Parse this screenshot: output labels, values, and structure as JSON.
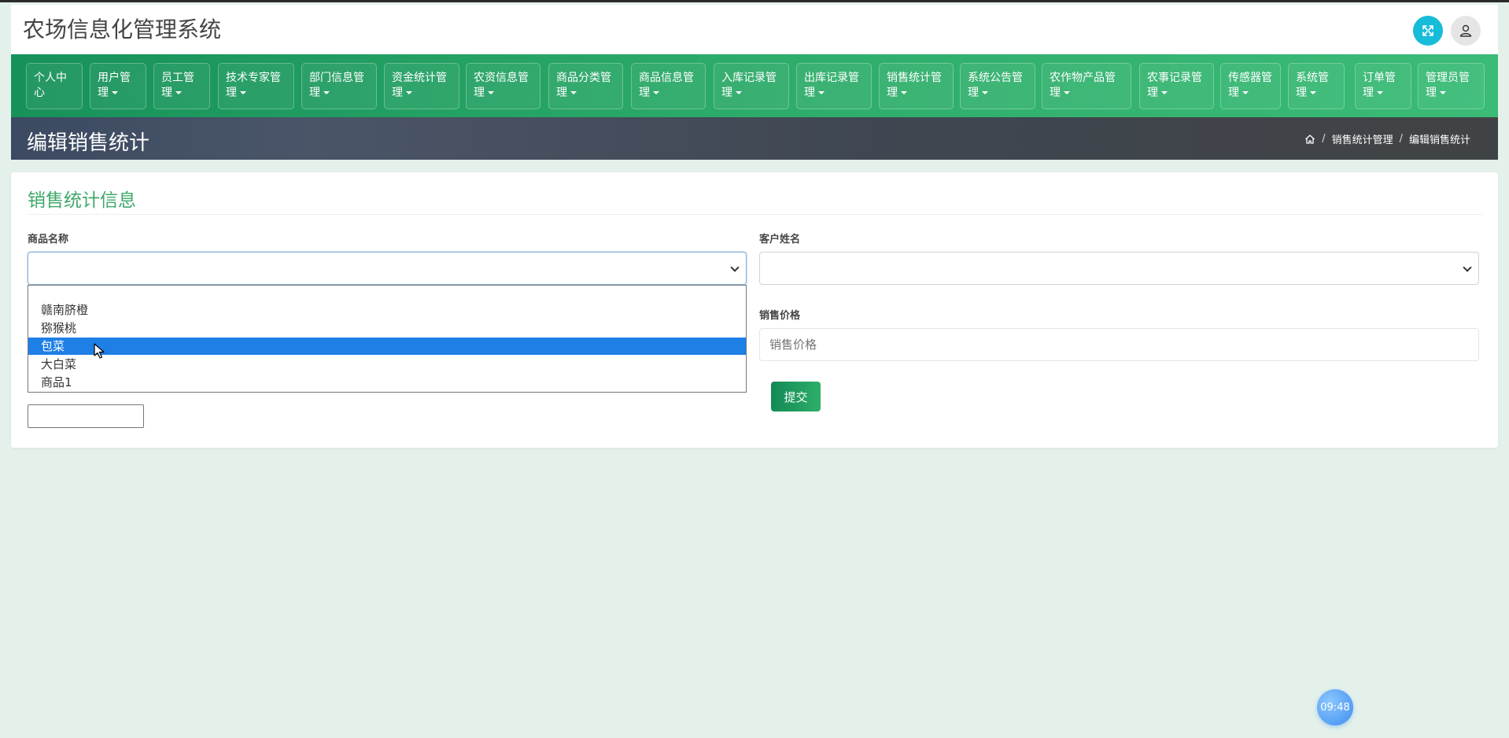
{
  "header": {
    "title": "农场信息化管理系统",
    "fullscreen_icon": "expand-arrows-icon",
    "avatar_icon": "user-icon"
  },
  "nav": {
    "items": [
      {
        "label": "个人中心",
        "dropdown": false
      },
      {
        "label": "用户管理",
        "dropdown": true
      },
      {
        "label": "员工管理",
        "dropdown": true
      },
      {
        "label": "技术专家管理",
        "dropdown": true
      },
      {
        "label": "部门信息管理",
        "dropdown": true
      },
      {
        "label": "资金统计管理",
        "dropdown": true
      },
      {
        "label": "农资信息管理",
        "dropdown": true
      },
      {
        "label": "商品分类管理",
        "dropdown": true
      },
      {
        "label": "商品信息管理",
        "dropdown": true
      },
      {
        "label": "入库记录管理",
        "dropdown": true
      },
      {
        "label": "出库记录管理",
        "dropdown": true
      },
      {
        "label": "销售统计管理",
        "dropdown": true
      },
      {
        "label": "系统公告管理",
        "dropdown": true
      },
      {
        "label": "农作物产品管理",
        "dropdown": true
      },
      {
        "label": "农事记录管理",
        "dropdown": true
      },
      {
        "label": "传感器管理",
        "dropdown": true
      },
      {
        "label": "系统管理",
        "dropdown": true
      },
      {
        "label": "订单管理",
        "dropdown": true
      },
      {
        "label": "管理员管理",
        "dropdown": true
      }
    ]
  },
  "page": {
    "title": "编辑销售统计",
    "breadcrumb": [
      "销售统计管理",
      "编辑销售统计"
    ]
  },
  "form": {
    "card_title": "销售统计信息",
    "product_name_label": "商品名称",
    "customer_name_label": "客户姓名",
    "sale_price_label": "销售价格",
    "sale_price_placeholder": "销售价格",
    "submit_label": "提交",
    "product_options": [
      "",
      "赣南脐橙",
      "猕猴桃",
      "包菜",
      "大白菜",
      "商品1"
    ],
    "highlighted_option": "包菜"
  },
  "clock": {
    "time": "09:48"
  },
  "colors": {
    "nav_green": "#2fae6b",
    "accent_title": "#3fa86a",
    "fullscreen_cyan": "#17bcd9",
    "highlight_blue": "#1e7fe6"
  }
}
